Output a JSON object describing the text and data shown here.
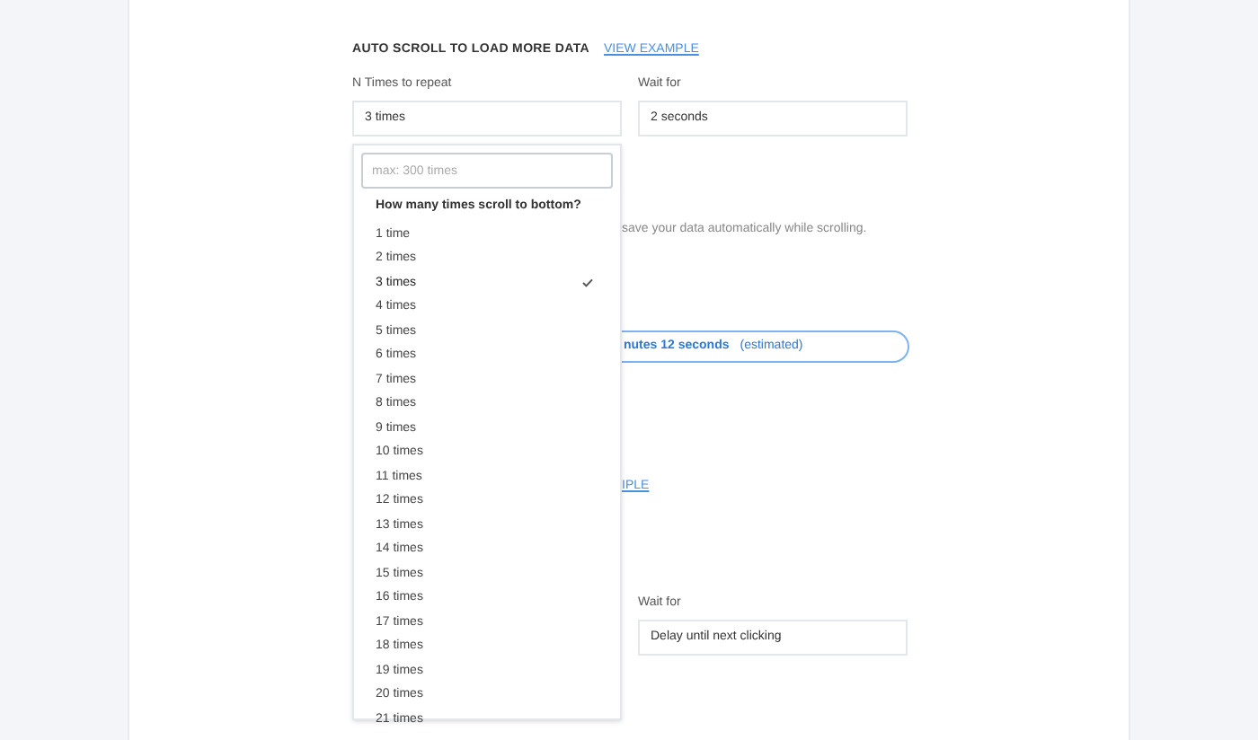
{
  "section": {
    "title": "AUTO SCROLL TO LOAD MORE DATA",
    "link": "VIEW EXAMPLE"
  },
  "fields": [
    {
      "label": "N Times to repeat",
      "value": "3 times"
    },
    {
      "label": "Wait for",
      "value": "2 seconds"
    }
  ],
  "dropdown": {
    "placeholder": "max: 300 times",
    "title": "How many times scroll to bottom?",
    "options": [
      {
        "label": "1 time",
        "selected": false
      },
      {
        "label": "2 times",
        "selected": false
      },
      {
        "label": "3 times",
        "selected": true
      },
      {
        "label": "4 times",
        "selected": false
      },
      {
        "label": "5 times",
        "selected": false
      },
      {
        "label": "6 times",
        "selected": false
      },
      {
        "label": "7 times",
        "selected": false
      },
      {
        "label": "8 times",
        "selected": false
      },
      {
        "label": "9 times",
        "selected": false
      },
      {
        "label": "10 times",
        "selected": false
      },
      {
        "label": "11 times",
        "selected": false
      },
      {
        "label": "12 times",
        "selected": false
      },
      {
        "label": "13 times",
        "selected": false
      },
      {
        "label": "14 times",
        "selected": false
      },
      {
        "label": "15 times",
        "selected": false
      },
      {
        "label": "16 times",
        "selected": false
      },
      {
        "label": "17 times",
        "selected": false
      },
      {
        "label": "18 times",
        "selected": false
      },
      {
        "label": "19 times",
        "selected": false
      },
      {
        "label": "20 times",
        "selected": false
      },
      {
        "label": "21 times",
        "selected": false
      }
    ]
  },
  "hint": "save your data automatically while scrolling.",
  "estimate": {
    "value": "nutes 12 seconds",
    "note": "(estimated)"
  },
  "link_fragment": "IPLE",
  "second_field": {
    "label": "Wait for",
    "value": "Delay until next clicking"
  }
}
